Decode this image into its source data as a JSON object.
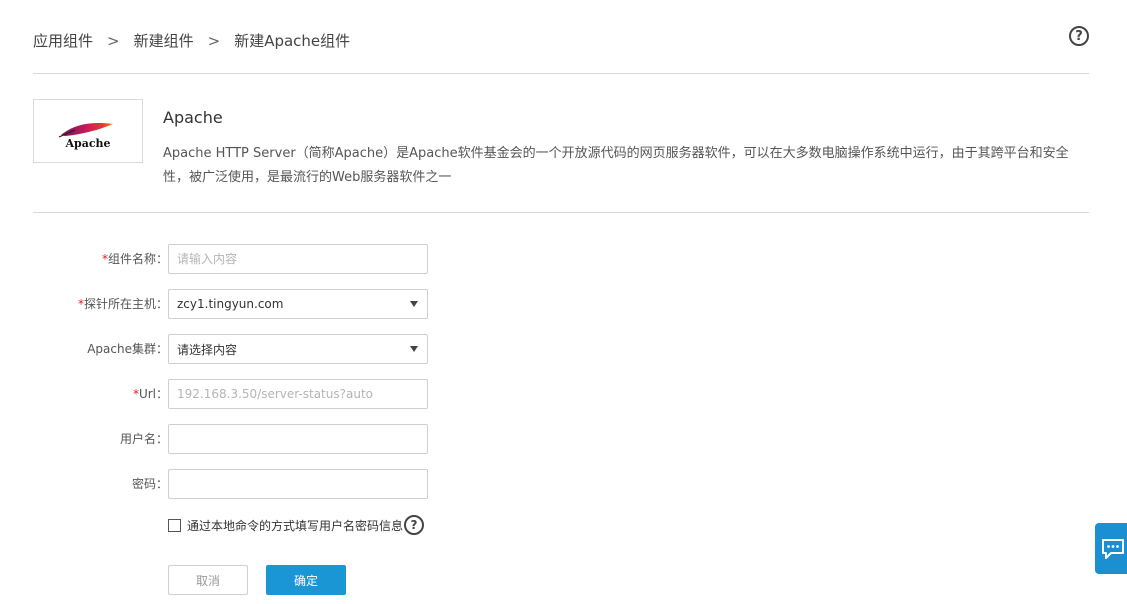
{
  "breadcrumb": {
    "items": [
      "应用组件",
      "新建组件",
      "新建Apache组件"
    ],
    "separator": ">"
  },
  "help_icon": "question-circle-icon",
  "component": {
    "logo_text": "Apache",
    "name": "Apache",
    "description": "Apache HTTP Server（简称Apache）是Apache软件基金会的一个开放源代码的网页服务器软件，可以在大多数电脑操作系统中运行，由于其跨平台和安全性，被广泛使用，是最流行的Web服务器软件之一"
  },
  "form": {
    "required_mark": "*",
    "component_name": {
      "label": "组件名称：",
      "value": "",
      "placeholder": "请输入内容"
    },
    "probe_host": {
      "label": "探针所在主机：",
      "value": "zcy1.tingyun.com"
    },
    "apache_cluster": {
      "label": "Apache集群：",
      "value": "请选择内容"
    },
    "url": {
      "label": "Url：",
      "value": "",
      "placeholder": "192.168.3.50/server-status?auto"
    },
    "username": {
      "label": "用户名：",
      "value": ""
    },
    "password": {
      "label": "密码：",
      "value": ""
    },
    "local_command_checkbox": {
      "label": "通过本地命令的方式填写用户名密码信息",
      "checked": false
    }
  },
  "buttons": {
    "cancel": "取消",
    "confirm": "确定"
  },
  "colors": {
    "primary": "#1a96d4",
    "required": "#e02020",
    "divider": "#d9d9d9"
  }
}
